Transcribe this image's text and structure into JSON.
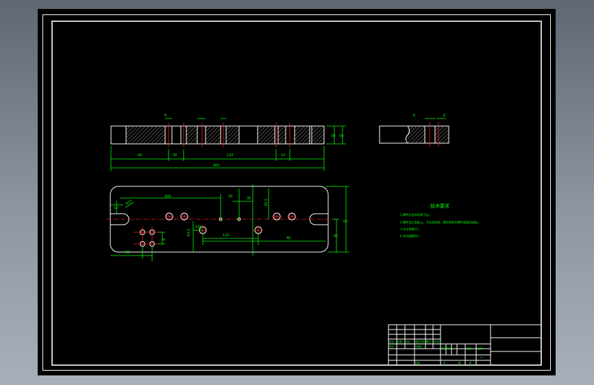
{
  "title_block": {
    "label_sign": "标记",
    "label_count": "处数",
    "label_zone": "分区",
    "label_change_no": "更改文件号",
    "label_signature": "签名",
    "label_date": "年月日",
    "label_design": "设计",
    "label_standardize": "标准化",
    "label_stage_mark": "阶段标记",
    "label_weight": "重量",
    "label_scale": "比例",
    "scale_value": "1:1",
    "label_approve": "批准",
    "label_sheet_total": "共",
    "label_sheet": "第",
    "label_page": "张"
  },
  "tech_requirements": {
    "heading": "技术要求",
    "lines": [
      "1.零件应去除毛刺飞边。",
      "2.零件加工表面上，不应有划痕、擦伤等损伤零件表面的缺陷。",
      "3.未注倒角C1。",
      "4.未注圆角R5。"
    ]
  },
  "dimensions": {
    "front": [
      "6",
      "60",
      "30",
      "120",
      "10",
      "450",
      "30",
      "50"
    ],
    "side": [
      "6",
      "8"
    ],
    "plan": [
      "200",
      "20",
      "30",
      "120",
      "40",
      "64.5",
      "60",
      "40",
      "10",
      "100",
      "25.5",
      "8",
      "80",
      "R15"
    ]
  },
  "colors": {
    "outline": "#ffffff",
    "dimension": "#00ff00",
    "centerline": "#ff2020",
    "background": "#000000",
    "ui_frame": "#7c8490"
  }
}
